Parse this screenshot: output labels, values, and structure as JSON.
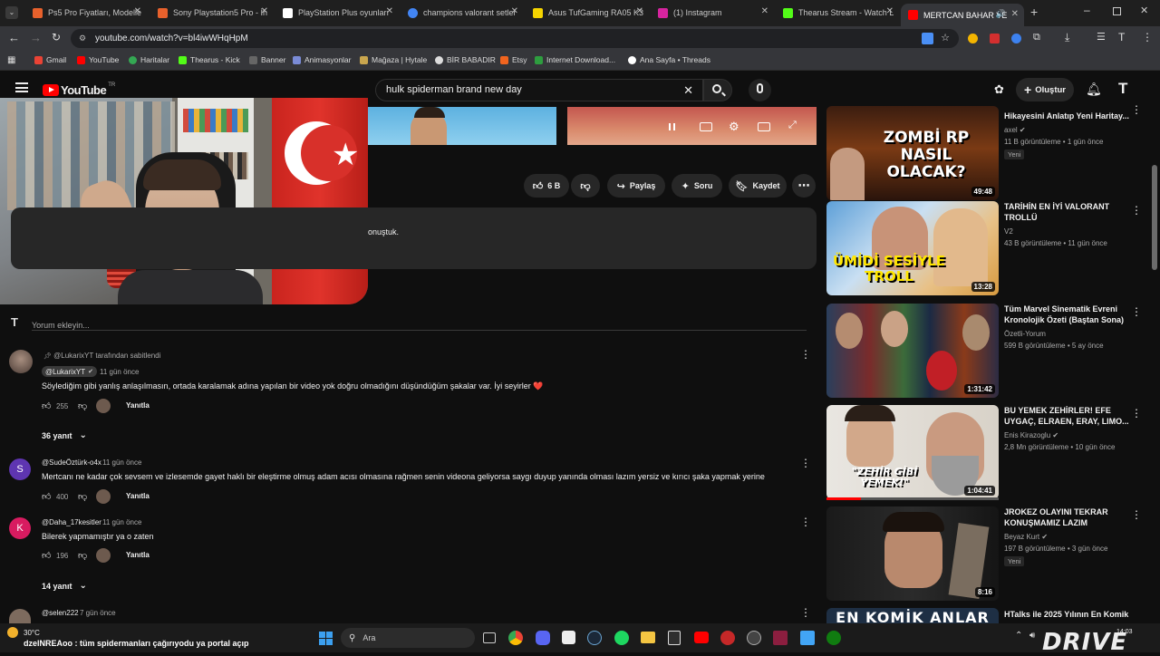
{
  "browser": {
    "tabs": [
      {
        "title": "Ps5 Pro Fiyatları, Modelle",
        "color": "#e8612c"
      },
      {
        "title": "Sony Playstation5 Pro - İh",
        "color": "#e8612c"
      },
      {
        "title": "PlayStation Plus oyunları",
        "color": "#ffffff"
      },
      {
        "title": "champions valorant setler",
        "color": "#4285f4"
      },
      {
        "title": "Asus TufGaming RA05 K3",
        "color": "#f5d400"
      },
      {
        "title": "(1) Instagram",
        "color": "#d6249f"
      },
      {
        "title": "Thearus Stream - Watch L",
        "color": "#53fc18"
      },
      {
        "title": "MERTCAN BAHAR VE",
        "color": "#ff0000"
      }
    ],
    "url": "youtube.com/watch?v=bl4iwWHqHpM",
    "bookmarks": [
      "Gmail",
      "YouTube",
      "Haritalar",
      "Thearus - Kick",
      "Banner",
      "Animasyonlar",
      "Mağaza | Hytale",
      "BİR BABADIR",
      "Etsy",
      "Internet Download...",
      "Ana Sayfa • Threads"
    ]
  },
  "youtube": {
    "logo": "YouTube",
    "logo_region": "TR",
    "search_value": "hulk spiderman brand new day",
    "create_label": "Oluştur"
  },
  "video_actions": {
    "likes": "6 B",
    "share": "Paylaş",
    "ask": "Soru",
    "save": "Kaydet"
  },
  "description_fragment": "onuştuk.",
  "comments": {
    "add_placeholder": "Yorum ekleyin...",
    "pinned_by": "@LukarixYT tarafından sabitlendi",
    "items": [
      {
        "author": "@LukarixYT",
        "time": "11 gün önce",
        "text": "Söylediğim gibi yanlış anlaşılmasın, ortada karalamak adına yapılan bir video yok doğru olmadığını düşündüğüm şakalar var. İyi seyirler ❤️",
        "likes": "255",
        "reply": "Yanıtla",
        "replies": "36 yanıt"
      },
      {
        "author": "@SudeÖztürk-o4x",
        "time": "11 gün önce",
        "text": "Mertcanı ne kadar çok sevsem ve izlesemde gayet haklı bir eleştirme olmuş adam acısı olmasına rağmen senin videona geliyorsa saygı duyup yanında olması lazım yersiz ve kırıcı şaka yapmak yerine",
        "likes": "400",
        "reply": "Yanıtla",
        "initial": "S"
      },
      {
        "author": "@Daha_17kesitler",
        "time": "11 gün önce",
        "text": "Bilerek yapmamıştır ya o zaten",
        "likes": "196",
        "reply": "Yanıtla",
        "initial": "K",
        "replies": "14 yanıt"
      },
      {
        "author": "@selen222",
        "time": "7 gün önce"
      }
    ]
  },
  "sidebar": [
    {
      "title": "Hikayesini Anlatıp Yeni Haritay...",
      "channel": "axel",
      "views": "11 B görüntüleme",
      "age": "1 gün önce",
      "duration": "49:48",
      "badge": "Yeni",
      "thumb_text": "ZOMBİ RP NASIL OLACAK?"
    },
    {
      "title": "TARİHİN EN İYİ VALORANT TROLLÜ",
      "channel": "V2",
      "views": "43 B görüntüleme",
      "age": "11 gün önce",
      "duration": "13:28",
      "thumb_text": "ÜMİDİ SESİYLE TROLL"
    },
    {
      "title": "Tüm Marvel Sinematik Evreni Kronolojik Özeti (Baştan Sona)",
      "channel": "Özetli-Yorum",
      "views": "599 B görüntüleme",
      "age": "5 ay önce",
      "duration": "1:31:42"
    },
    {
      "title": "BU YEMEK ZEHİRLER! EFE UYGAÇ, ELRAEN, ERAY, LIMO...",
      "channel": "Enis Kirazoglu",
      "views": "2,8 Mn görüntüleme",
      "age": "10 gün önce",
      "duration": "1:04:41",
      "thumb_text": "\"ZEHİR GİBİ YEMEK!\""
    },
    {
      "title": "JROKEZ OLAYINI TEKRAR KONUŞMAMIZ LAZIM",
      "channel": "Beyaz Kurt",
      "views": "197 B görüntüleme",
      "age": "3 gün önce",
      "duration": "8:16",
      "badge": "Yeni"
    },
    {
      "title": "HTalks ile 2025 Yılının En Komik",
      "thumb_text": "EN KOMİK ANLAR"
    }
  ],
  "taskbar": {
    "temp": "30°C",
    "ticker": "dzelNREAoo : tüm spidermanları çağırıyodu ya portal açıp",
    "search": "Ara",
    "time": "14:03",
    "watermark": "DRIVE"
  }
}
